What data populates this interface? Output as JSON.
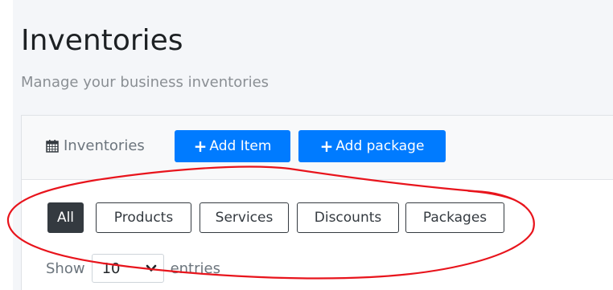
{
  "page": {
    "title": "Inventories",
    "subtitle": "Manage your business inventories"
  },
  "card": {
    "header_label": "Inventories",
    "header_icon": "calendar-icon",
    "add_item_label": "Add Item",
    "add_package_label": "Add package",
    "plus_glyph": "+"
  },
  "filters": {
    "all": "All",
    "products": "Products",
    "services": "Services",
    "discounts": "Discounts",
    "packages": "Packages",
    "active": "All"
  },
  "entries": {
    "show_label": "Show",
    "selected": "10",
    "entries_label": "entries"
  },
  "colors": {
    "primary": "#007bff",
    "dark": "#343a40",
    "annotation": "#e8141c"
  }
}
